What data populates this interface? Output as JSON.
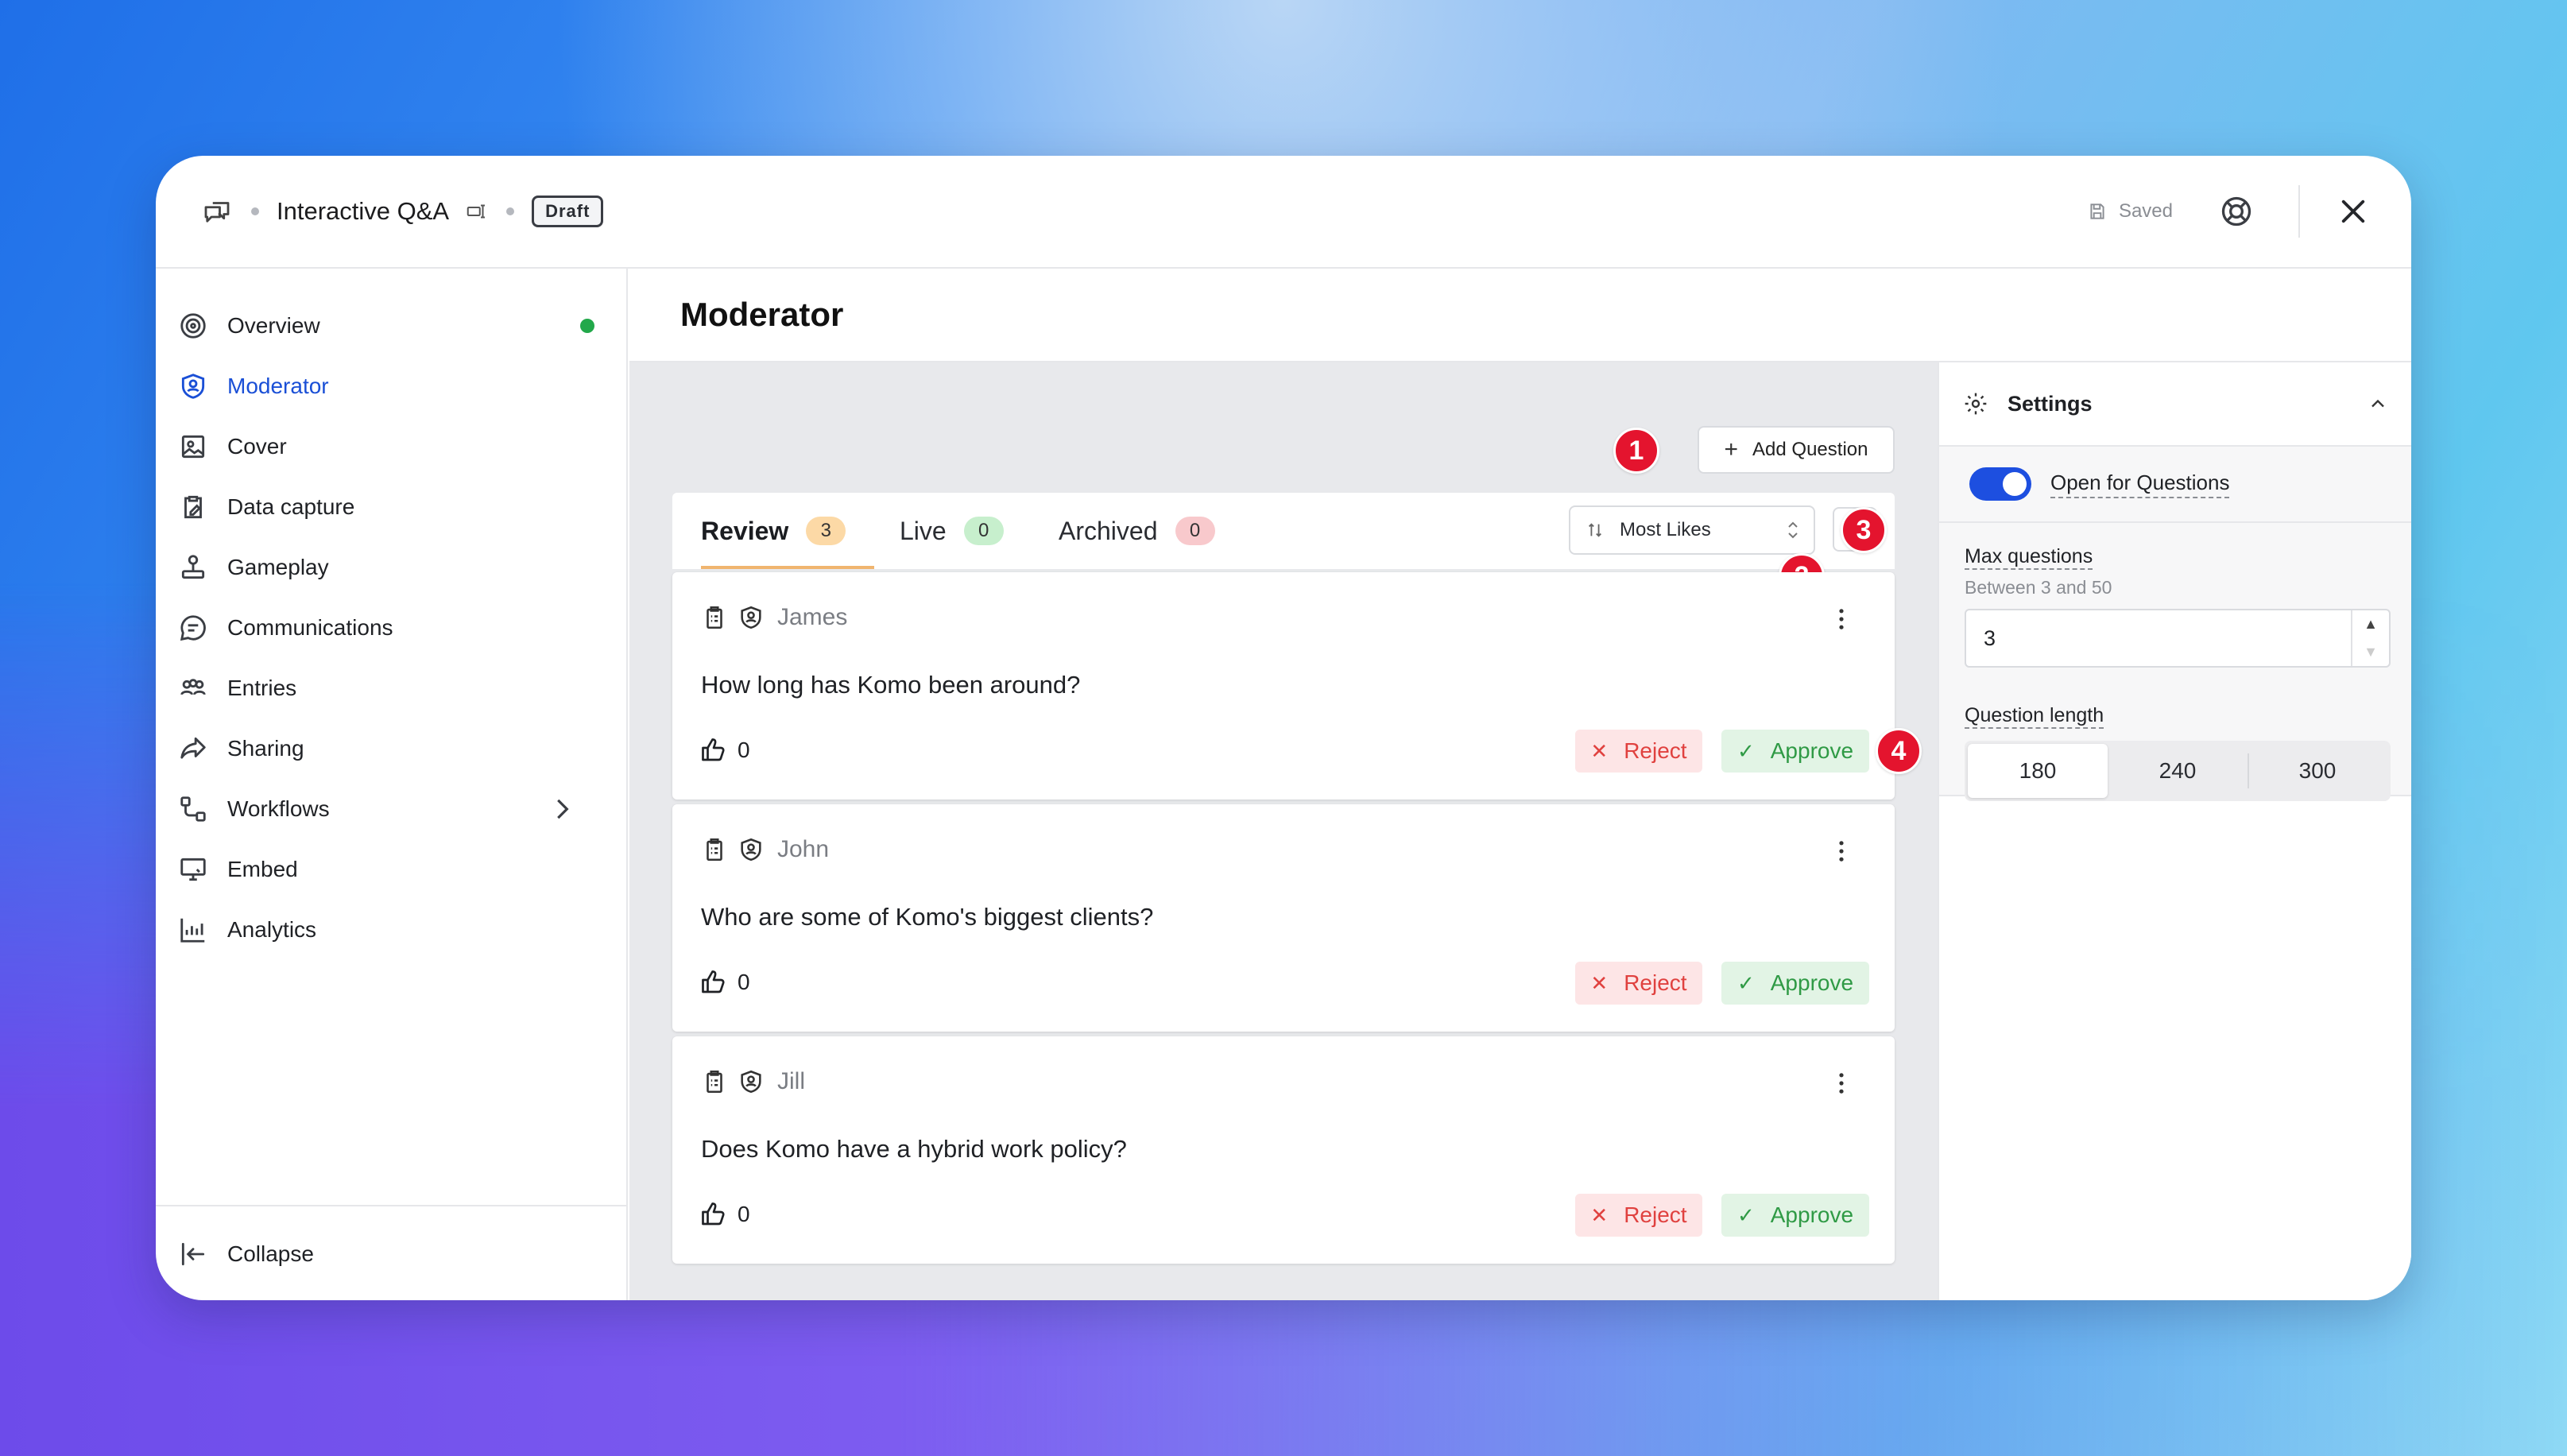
{
  "header": {
    "app_title": "Interactive Q&A",
    "status_badge": "Draft",
    "saved_label": "Saved"
  },
  "sidebar": {
    "items": [
      {
        "label": "Overview",
        "icon": "target-icon",
        "status_dot_color": "#22a84a"
      },
      {
        "label": "Moderator",
        "icon": "shield-user-icon",
        "active": true
      },
      {
        "label": "Cover",
        "icon": "image-icon"
      },
      {
        "label": "Data capture",
        "icon": "clipboard-edit-icon"
      },
      {
        "label": "Gameplay",
        "icon": "joystick-icon"
      },
      {
        "label": "Communications",
        "icon": "chat-icon"
      },
      {
        "label": "Entries",
        "icon": "users-icon"
      },
      {
        "label": "Sharing",
        "icon": "share-icon"
      },
      {
        "label": "Workflows",
        "icon": "workflow-icon",
        "has_submenu": true
      },
      {
        "label": "Embed",
        "icon": "monitor-icon"
      },
      {
        "label": "Analytics",
        "icon": "chart-icon"
      }
    ],
    "collapse_label": "Collapse"
  },
  "main": {
    "page_title": "Moderator",
    "add_question_label": "Add Question",
    "tabs": [
      {
        "label": "Review",
        "count": "3",
        "badge_color": "#fcd9a6",
        "active": true
      },
      {
        "label": "Live",
        "count": "0",
        "badge_color": "#c7efcd"
      },
      {
        "label": "Archived",
        "count": "0",
        "badge_color": "#f8c9cc"
      }
    ],
    "sort": {
      "selected": "Most Likes"
    },
    "markers": [
      "1",
      "2",
      "3",
      "4"
    ],
    "questions": [
      {
        "author": "James",
        "text": "How long has Komo been around?",
        "likes": "0"
      },
      {
        "author": "John",
        "text": "Who are some of Komo's biggest clients?",
        "likes": "0"
      },
      {
        "author": "Jill",
        "text": "Does Komo have a hybrid work policy?",
        "likes": "0"
      }
    ],
    "reject_label": "Reject",
    "approve_label": "Approve"
  },
  "settings": {
    "title": "Settings",
    "open_for_questions_label": "Open for Questions",
    "open_for_questions_enabled": true,
    "max_questions_label": "Max questions",
    "max_questions_hint": "Between 3 and 50",
    "max_questions_value": "3",
    "question_length_label": "Question length",
    "question_length_options": [
      "180",
      "240",
      "300"
    ],
    "question_length_selected": "180"
  },
  "colors": {
    "accent": "#1a4fd6",
    "marker": "#e4142e",
    "reject_text": "#e0413f",
    "approve_text": "#2f9a45"
  }
}
